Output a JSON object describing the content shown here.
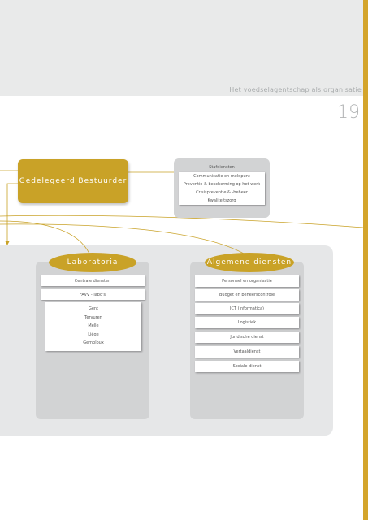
{
  "header": {
    "title": "Het voedselagentschap als organisatie",
    "page_number": "19"
  },
  "colors": {
    "gold": "#c9a227",
    "accent_bar": "#d4a52c"
  },
  "delegated": {
    "label": "Gedelegeerd Bestuurder"
  },
  "staff": {
    "title": "Stafdiensten",
    "items": [
      "Communicatie en meldpunt",
      "Preventie & bescherming op het werk",
      "Crisispreventie & -beheer",
      "Kwaliteitszorg"
    ]
  },
  "laboratoria": {
    "label": "Laboratoria",
    "central": "Centrale diensten",
    "favv": "FAVV - labo's",
    "labs": [
      "Gent",
      "Tervuren",
      "Melle",
      "Liège",
      "Gembloux"
    ]
  },
  "algemene": {
    "label": "Algemene diensten",
    "items": [
      "Personeel en organisatie",
      "Budget en beheerscontrole",
      "ICT (informatica)",
      "Logistiek",
      "Juridische dienst",
      "Vertaaldienst",
      "Sociale dienst"
    ]
  }
}
